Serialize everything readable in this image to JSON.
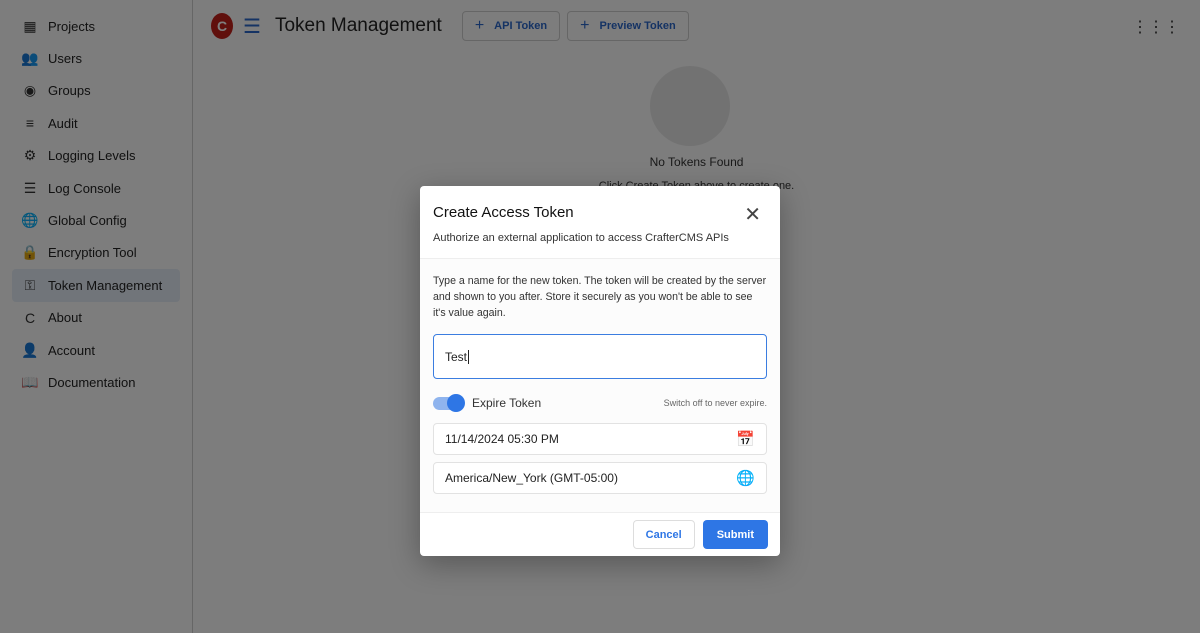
{
  "sidebar": {
    "items": [
      {
        "label": "Projects",
        "icon": "projects-icon",
        "glyph": "▦"
      },
      {
        "label": "Users",
        "icon": "users-icon",
        "glyph": "👥"
      },
      {
        "label": "Groups",
        "icon": "groups-icon",
        "glyph": "◉"
      },
      {
        "label": "Audit",
        "icon": "audit-icon",
        "glyph": "≡"
      },
      {
        "label": "Logging Levels",
        "icon": "logging-levels-icon",
        "glyph": "⚙"
      },
      {
        "label": "Log Console",
        "icon": "log-console-icon",
        "glyph": "☰"
      },
      {
        "label": "Global Config",
        "icon": "globe-icon",
        "glyph": "🌐"
      },
      {
        "label": "Encryption Tool",
        "icon": "encryption-icon",
        "glyph": "🔒"
      },
      {
        "label": "Token Management",
        "icon": "key-icon",
        "glyph": "⚿",
        "active": true
      },
      {
        "label": "About",
        "icon": "crafter-icon",
        "glyph": "C"
      },
      {
        "label": "Account",
        "icon": "account-icon",
        "glyph": "👤"
      },
      {
        "label": "Documentation",
        "icon": "book-icon",
        "glyph": "📖"
      }
    ]
  },
  "header": {
    "logo": "C",
    "title": "Token Management",
    "api_token": "API Token",
    "preview_token": "Preview Token"
  },
  "empty": {
    "title": "No Tokens Found",
    "subtitle": "Click Create Token above to create one."
  },
  "dialog": {
    "title": "Create Access Token",
    "subtitle": "Authorize an external application to access CrafterCMS APIs",
    "description": "Type a name for the new token. The token will be created by the server and shown to you after. Store it securely as you won't be able to see it's value again.",
    "name_value": "Test",
    "expire_label": "Expire Token",
    "expire_enabled": true,
    "expire_hint": "Switch off to never expire.",
    "date_value": "11/14/2024 05:30 PM",
    "timezone_value": "America/New_York (GMT-05:00)",
    "cancel": "Cancel",
    "submit": "Submit"
  },
  "colors": {
    "accent": "#2e76e5",
    "logo": "#c0201a"
  }
}
